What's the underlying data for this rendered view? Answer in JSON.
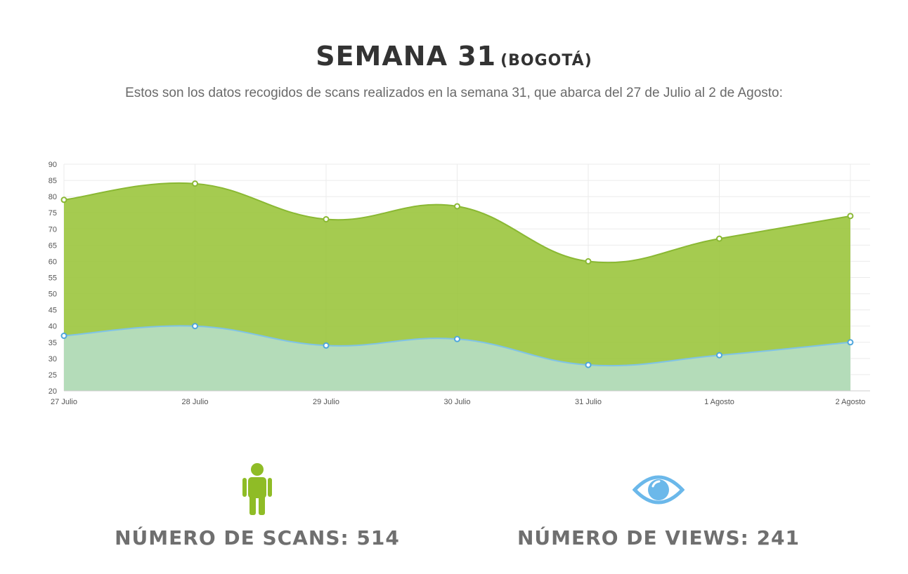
{
  "header": {
    "title": "SEMANA 31",
    "title_suffix": "(BOGOTÁ)",
    "subtitle": "Estos son los datos recogidos de scans realizados en la semana 31, que abarca del 27 de Julio al 2 de Agosto:"
  },
  "chart_data": {
    "type": "area",
    "categories": [
      "27 Julio",
      "28 Julio",
      "29 Julio",
      "30 Julio",
      "31 Julio",
      "1 Agosto",
      "2 Agosto"
    ],
    "series": [
      {
        "values": [
          79,
          84,
          73,
          77,
          60,
          67,
          74
        ],
        "color": "#9bc53d"
      },
      {
        "values": [
          37,
          40,
          34,
          36,
          28,
          31,
          35
        ],
        "color": "#b4dcb9"
      }
    ],
    "ylim": [
      20,
      90
    ],
    "yticks": [
      20,
      25,
      30,
      35,
      40,
      45,
      50,
      55,
      60,
      65,
      70,
      75,
      80,
      85,
      90
    ],
    "grid": true,
    "title": "",
    "xlabel": "",
    "ylabel": ""
  },
  "stats": {
    "scans": {
      "label": "NÚMERO DE SCANS: 514",
      "icon": "person-icon",
      "color": "#8fbc26"
    },
    "views": {
      "label": "NÚMERO DE VIEWS: 241",
      "icon": "eye-icon",
      "color": "#6bb8ea"
    }
  }
}
